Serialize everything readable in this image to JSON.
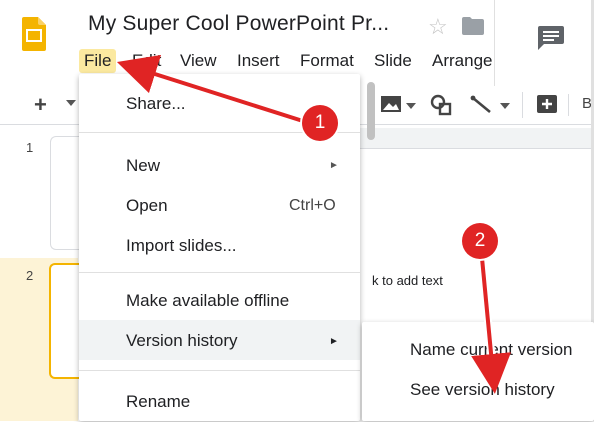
{
  "app": {
    "title": "My Super Cool PowerPoint Pr..."
  },
  "menubar": {
    "items": [
      {
        "label": "File"
      },
      {
        "label": "Edit"
      },
      {
        "label": "View"
      },
      {
        "label": "Insert"
      },
      {
        "label": "Format"
      },
      {
        "label": "Slide"
      },
      {
        "label": "Arrange"
      }
    ]
  },
  "toolbar": {
    "add_label": "+",
    "overflow_label": "B"
  },
  "filmstrip": {
    "slides": [
      {
        "number": "1"
      },
      {
        "number": "2"
      }
    ]
  },
  "canvas": {
    "placeholder": "k to add text"
  },
  "file_menu": {
    "share": "Share...",
    "new": "New",
    "open": "Open",
    "open_shortcut": "Ctrl+O",
    "import": "Import slides...",
    "offline": "Make available offline",
    "version_history": "Version history",
    "rename": "Rename",
    "submenu_arrow": "►"
  },
  "version_submenu": {
    "name_current": "Name current version",
    "see_history": "See version history"
  },
  "annotations": {
    "badge_1": "1",
    "badge_2": "2",
    "color": "#e02424"
  },
  "colors": {
    "file_highlight": "#fbe9a0",
    "active_slide_border": "#f4b400",
    "logo": "#f4b400"
  }
}
